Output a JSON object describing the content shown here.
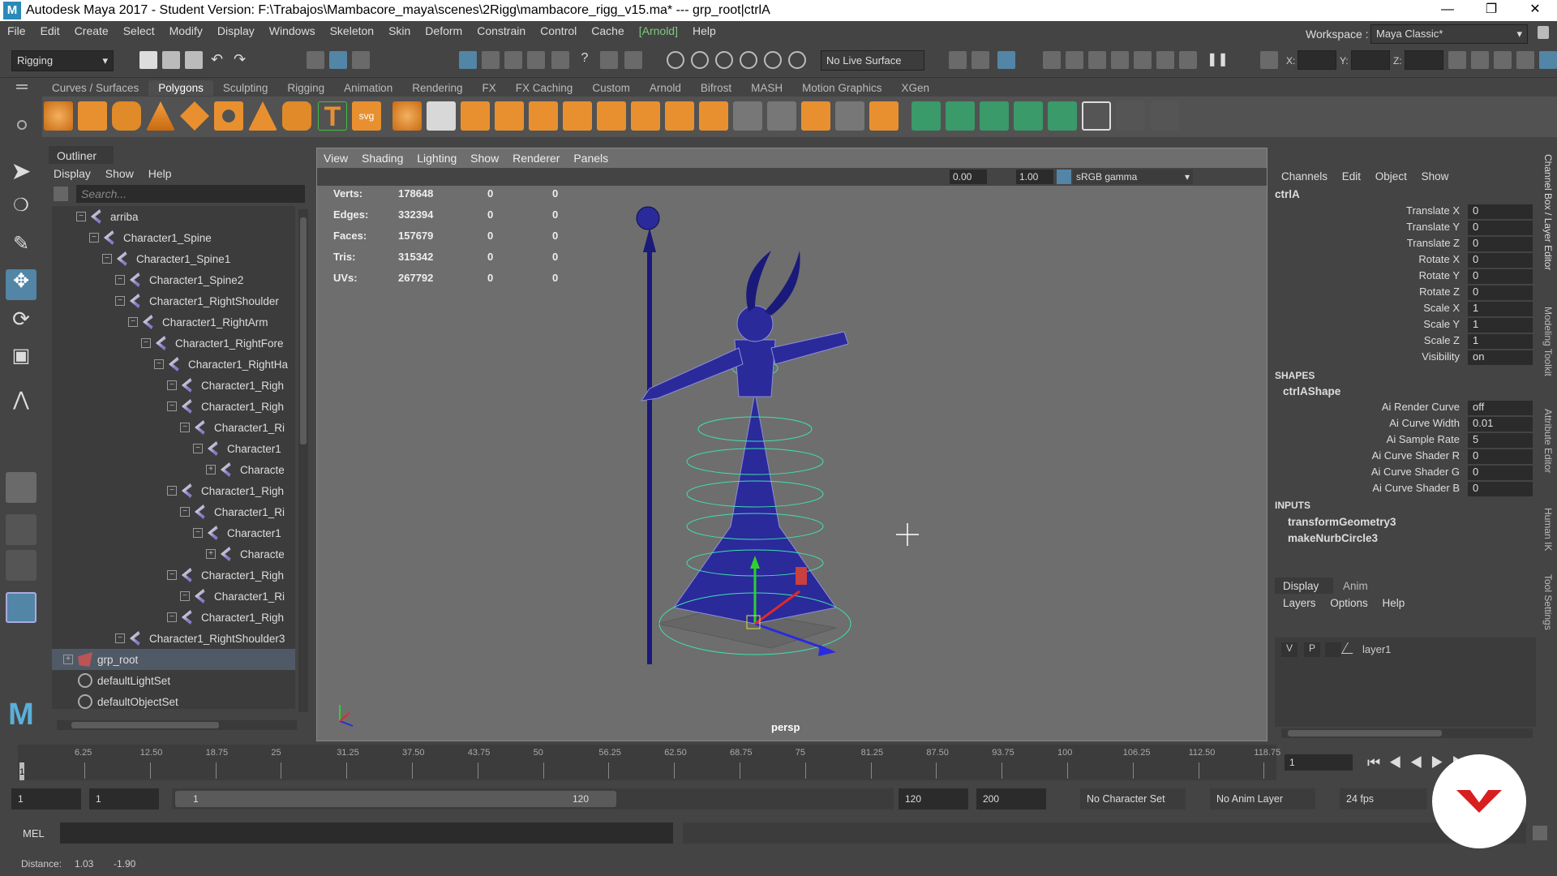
{
  "title": {
    "text": "Autodesk Maya 2017 - Student Version: F:\\Trabajos\\Mambacore_maya\\scenes\\2Rigg\\mambacore_rigg_v15.ma*   ---   grp_root|ctrlA"
  },
  "menubar": [
    "File",
    "Edit",
    "Create",
    "Select",
    "Modify",
    "Display",
    "Windows",
    "Skeleton",
    "Skin",
    "Deform",
    "Constrain",
    "Control",
    "Cache",
    "[Arnold]",
    "Help"
  ],
  "statusline": {
    "menuset": "Rigging",
    "live_surface": "No Live Surface",
    "x_label": "X:",
    "y_label": "Y:",
    "z_label": "Z:",
    "workspace_label": "Workspace :",
    "workspace_value": "Maya Classic*"
  },
  "shelf_tabs": [
    "Curves / Surfaces",
    "Polygons",
    "Sculpting",
    "Rigging",
    "Animation",
    "Rendering",
    "FX",
    "FX Caching",
    "Custom",
    "Arnold",
    "Bifrost",
    "MASH",
    "Motion Graphics",
    "XGen"
  ],
  "outliner": {
    "title": "Outliner",
    "menu": "Display Show Help",
    "search_placeholder": "Search...",
    "rows": [
      {
        "label": "arriba",
        "indent": 1
      },
      {
        "label": "Character1_Spine",
        "indent": 2
      },
      {
        "label": "Character1_Spine1",
        "indent": 3
      },
      {
        "label": "Character1_Spine2",
        "indent": 4
      },
      {
        "label": "Character1_RightShoulder",
        "indent": 4
      },
      {
        "label": "Character1_RightArm",
        "indent": 5
      },
      {
        "label": "Character1_RightFore",
        "indent": 6
      },
      {
        "label": "Character1_RightHa",
        "indent": 7
      },
      {
        "label": "Character1_Righ",
        "indent": 8
      },
      {
        "label": "Character1_Righ",
        "indent": 8
      },
      {
        "label": "Character1_Ri",
        "indent": 9
      },
      {
        "label": "Character1",
        "indent": 10
      },
      {
        "label": "Characte",
        "indent": 11
      },
      {
        "label": "Character1_Righ",
        "indent": 8
      },
      {
        "label": "Character1_Ri",
        "indent": 9
      },
      {
        "label": "Character1",
        "indent": 10
      },
      {
        "label": "Characte",
        "indent": 11
      },
      {
        "label": "Character1_Righ",
        "indent": 8
      },
      {
        "label": "Character1_Ri",
        "indent": 9
      },
      {
        "label": "Character1_Righ",
        "indent": 8
      },
      {
        "label": "Character1_RightShoulder3",
        "indent": 4
      },
      {
        "label": "grp_root",
        "indent": 0,
        "selected": true
      },
      {
        "label": "defaultLightSet",
        "indent": 0
      },
      {
        "label": "defaultObjectSet",
        "indent": 0
      }
    ]
  },
  "viewport": {
    "menu": "View Shading Lighting Show Renderer Panels",
    "exposure": "0.00",
    "gamma": "1.00",
    "colorspace": "sRGB gamma",
    "camera": "persp",
    "hud": [
      {
        "k": "Verts:",
        "v": "178648",
        "a": "0",
        "b": "0"
      },
      {
        "k": "Edges:",
        "v": "332394",
        "a": "0",
        "b": "0"
      },
      {
        "k": "Faces:",
        "v": "157679",
        "a": "0",
        "b": "0"
      },
      {
        "k": "Tris:",
        "v": "315342",
        "a": "0",
        "b": "0"
      },
      {
        "k": "UVs:",
        "v": "267792",
        "a": "0",
        "b": "0"
      }
    ]
  },
  "channelbox": {
    "menu": "Channels Edit Object Show",
    "node": "ctrlA",
    "channels": [
      {
        "l": "Translate X",
        "v": "0"
      },
      {
        "l": "Translate Y",
        "v": "0"
      },
      {
        "l": "Translate Z",
        "v": "0"
      },
      {
        "l": "Rotate X",
        "v": "0"
      },
      {
        "l": "Rotate Y",
        "v": "0"
      },
      {
        "l": "Rotate Z",
        "v": "0"
      },
      {
        "l": "Scale X",
        "v": "1"
      },
      {
        "l": "Scale Y",
        "v": "1"
      },
      {
        "l": "Scale Z",
        "v": "1"
      },
      {
        "l": "Visibility",
        "v": "on"
      }
    ],
    "shapes_header": "SHAPES",
    "shape_node": "ctrlAShape",
    "shape_channels": [
      {
        "l": "Ai Render Curve",
        "v": "off"
      },
      {
        "l": "Ai Curve Width",
        "v": "0.01"
      },
      {
        "l": "Ai Sample Rate",
        "v": "5"
      },
      {
        "l": "Ai Curve Shader R",
        "v": "0"
      },
      {
        "l": "Ai Curve Shader G",
        "v": "0"
      },
      {
        "l": "Ai Curve Shader B",
        "v": "0"
      }
    ],
    "inputs_header": "INPUTS",
    "inputs": [
      "transformGeometry3",
      "makeNurbCircle3"
    ]
  },
  "layers": {
    "tabs": [
      "Display",
      "Anim"
    ],
    "menu": "Layers Options Help",
    "row": {
      "v": "V",
      "p": "P",
      "name": "layer1"
    }
  },
  "right_strip": [
    "Channel Box / Layer Editor",
    "Modeling Toolkit",
    "Attribute Editor",
    "Human IK",
    "Tool Settings"
  ],
  "timeline": {
    "ticks": [
      "6.25",
      "12.50",
      "18.75",
      "25",
      "31.25",
      "37.50",
      "43.75",
      "50",
      "56.25",
      "62.50",
      "68.75",
      "75",
      "81.25",
      "87.50",
      "93.75",
      "100",
      "106.25",
      "112.50",
      "118.75"
    ],
    "start_frame": "1",
    "current_frame": "1"
  },
  "range": {
    "start": "1",
    "anim_start": "1",
    "slider_start": "1",
    "slider_end": "120",
    "end": "120",
    "anim_end": "200",
    "character_set": "No Character Set",
    "anim_layer": "No Anim Layer",
    "fps": "24 fps"
  },
  "cmd": {
    "label": "MEL"
  },
  "helpline": {
    "distance_label": "Distance:",
    "d1": "1.03",
    "d2": "-1.90"
  },
  "colors": {
    "accent": "#5285a6",
    "curve": "#3fe0b0",
    "mesh": "#2a2a9a",
    "arnold": "#7ec97e"
  }
}
